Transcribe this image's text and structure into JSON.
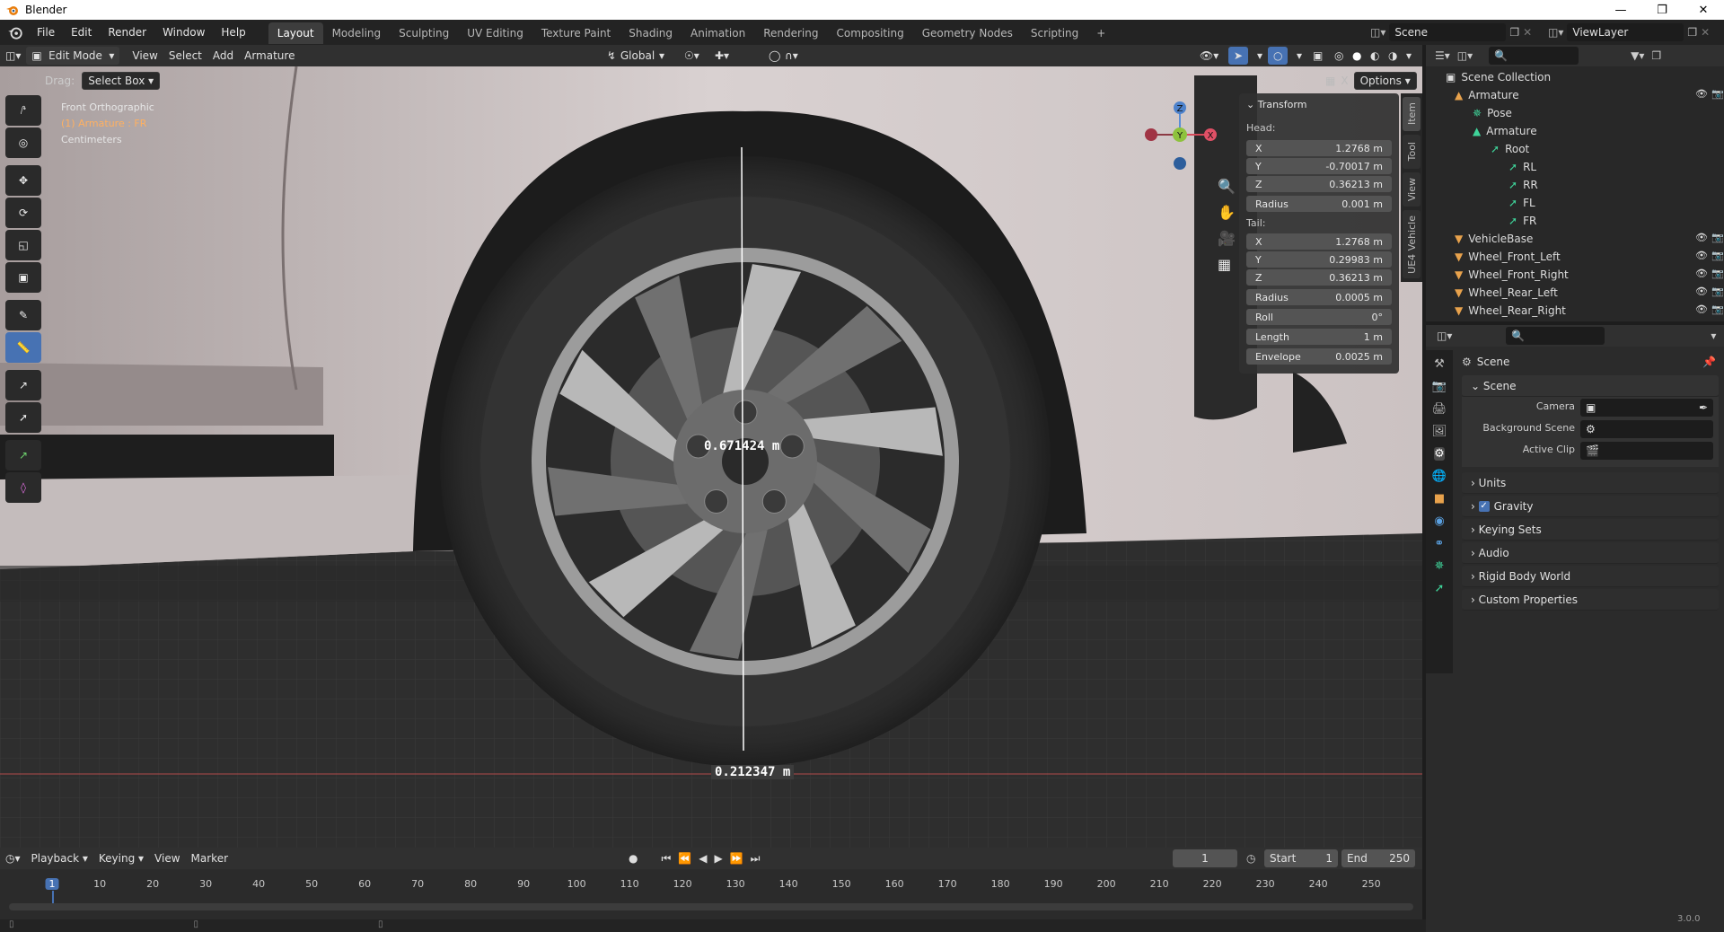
{
  "window": {
    "title": "Blender",
    "version": "3.0.0"
  },
  "menus": [
    "File",
    "Edit",
    "Render",
    "Window",
    "Help"
  ],
  "workspaces": [
    "Layout",
    "Modeling",
    "Sculpting",
    "UV Editing",
    "Texture Paint",
    "Shading",
    "Animation",
    "Rendering",
    "Compositing",
    "Geometry Nodes",
    "Scripting"
  ],
  "active_workspace": "Layout",
  "scene_field": "Scene",
  "view_layer_field": "ViewLayer",
  "viewport_header": {
    "mode": "Edit Mode",
    "menus": [
      "View",
      "Select",
      "Add",
      "Armature"
    ],
    "orientation": "Global",
    "drag_label": "Drag:",
    "drag_value": "Select Box",
    "options": "Options"
  },
  "viewport_overlay": {
    "view_name": "Front Orthographic",
    "object_info": "(1) Armature : FR",
    "units": "Centimeters",
    "measure_vertical": "0.671424 m",
    "measure_horizontal": "0.212347 m"
  },
  "gizmo": {
    "z": "Z",
    "y": "Y",
    "x": "X"
  },
  "npanel": {
    "section": "Transform",
    "head_label": "Head:",
    "tail_label": "Tail:",
    "head": [
      {
        "label": "X",
        "value": "1.2768 m"
      },
      {
        "label": "Y",
        "value": "-0.70017 m"
      },
      {
        "label": "Z",
        "value": "0.36213 m"
      }
    ],
    "head_radius": {
      "label": "Radius",
      "value": "0.001 m"
    },
    "tail": [
      {
        "label": "X",
        "value": "1.2768 m"
      },
      {
        "label": "Y",
        "value": "0.29983 m"
      },
      {
        "label": "Z",
        "value": "0.36213 m"
      }
    ],
    "tail_radius": {
      "label": "Radius",
      "value": "0.0005 m"
    },
    "roll": {
      "label": "Roll",
      "value": "0°"
    },
    "length": {
      "label": "Length",
      "value": "1 m"
    },
    "envelope": {
      "label": "Envelope",
      "value": "0.0025 m"
    },
    "tabs": [
      "Item",
      "Tool",
      "View",
      "UE4 Vehicle"
    ]
  },
  "outliner": {
    "root": "Scene Collection",
    "items": [
      {
        "label": "Armature",
        "indent": 1
      },
      {
        "label": "Pose",
        "indent": 2
      },
      {
        "label": "Armature",
        "indent": 2
      },
      {
        "label": "Root",
        "indent": 3
      },
      {
        "label": "RL",
        "indent": 4
      },
      {
        "label": "RR",
        "indent": 4
      },
      {
        "label": "FL",
        "indent": 4
      },
      {
        "label": "FR",
        "indent": 4
      },
      {
        "label": "VehicleBase",
        "indent": 1
      },
      {
        "label": "Wheel_Front_Left",
        "indent": 1
      },
      {
        "label": "Wheel_Front_Right",
        "indent": 1
      },
      {
        "label": "Wheel_Rear_Left",
        "indent": 1
      },
      {
        "label": "Wheel_Rear_Right",
        "indent": 1
      }
    ]
  },
  "properties": {
    "context": "Scene",
    "panel": "Scene",
    "camera_label": "Camera",
    "bg_scene_label": "Background Scene",
    "active_clip_label": "Active Clip",
    "sections": [
      "Units",
      "Gravity",
      "Keying Sets",
      "Audio",
      "Rigid Body World",
      "Custom Properties"
    ]
  },
  "timeline": {
    "menus": [
      "Playback",
      "Keying",
      "View",
      "Marker"
    ],
    "current_frame": "1",
    "start_label": "Start",
    "start": "1",
    "end_label": "End",
    "end": "250",
    "ticks": [
      "1",
      "10",
      "20",
      "30",
      "40",
      "50",
      "60",
      "70",
      "80",
      "90",
      "100",
      "110",
      "120",
      "130",
      "140",
      "150",
      "160",
      "170",
      "180",
      "190",
      "200",
      "210",
      "220",
      "230",
      "240",
      "250"
    ]
  }
}
